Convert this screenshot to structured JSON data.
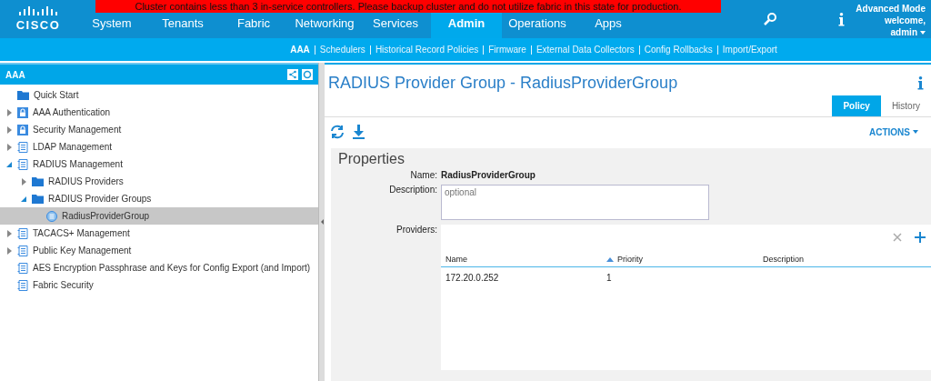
{
  "banner": {
    "text": "Cluster contains less than 3 in-service controllers. Please backup cluster and do not utilize fabric in this state for production."
  },
  "brand": {
    "logo_text": "CISCO"
  },
  "nav": [
    {
      "label": "System",
      "selected": false
    },
    {
      "label": "Tenants",
      "selected": false
    },
    {
      "label": "Fabric",
      "selected": false
    },
    {
      "label": "Networking",
      "selected": false
    },
    {
      "label": "Services",
      "selected": false
    },
    {
      "label": "Admin",
      "selected": true
    },
    {
      "label": "Operations",
      "selected": false
    },
    {
      "label": "Apps",
      "selected": false
    }
  ],
  "user": {
    "mode": "Advanced Mode",
    "welcome": "welcome,",
    "name": "admin"
  },
  "subnav": [
    "AAA",
    "Schedulers",
    "Historical Record Policies",
    "Firmware",
    "External Data Collectors",
    "Config Rollbacks",
    "Import/Export"
  ],
  "sidebar": {
    "title": "AAA",
    "items": [
      {
        "label": "Quick Start",
        "kind": "folder",
        "selected": false
      },
      {
        "label": "AAA Authentication",
        "kind": "lock",
        "expanded": false,
        "selected": false
      },
      {
        "label": "Security Management",
        "kind": "lock",
        "expanded": false,
        "selected": false
      },
      {
        "label": "LDAP Management",
        "kind": "doc",
        "expanded": false,
        "selected": false
      },
      {
        "label": "RADIUS Management",
        "kind": "doc",
        "expanded": true,
        "selected": false,
        "children": [
          {
            "label": "RADIUS Providers",
            "kind": "folder",
            "expanded": false,
            "selected": false
          },
          {
            "label": "RADIUS Provider Groups",
            "kind": "folder",
            "expanded": true,
            "selected": false,
            "children": [
              {
                "label": "RadiusProviderGroup",
                "kind": "object",
                "selected": true
              }
            ]
          }
        ]
      },
      {
        "label": "TACACS+ Management",
        "kind": "doc",
        "expanded": false,
        "selected": false
      },
      {
        "label": "Public Key Management",
        "kind": "doc",
        "expanded": false,
        "selected": false
      },
      {
        "label": "AES Encryption Passphrase and Keys for Config Export (and Import)",
        "kind": "doc",
        "selected": false
      },
      {
        "label": "Fabric Security",
        "kind": "doc",
        "selected": false
      }
    ]
  },
  "page": {
    "title": "RADIUS Provider Group - RadiusProviderGroup",
    "tabs": [
      {
        "label": "Policy",
        "selected": true
      },
      {
        "label": "History",
        "selected": false
      }
    ],
    "actions": "ACTIONS",
    "properties": {
      "title": "Properties",
      "name_label": "Name:",
      "name_value": "RadiusProviderGroup",
      "description_label": "Description:",
      "description_placeholder": "optional",
      "providers_label": "Providers:",
      "table": {
        "columns": [
          {
            "label": "Name",
            "sorted": false
          },
          {
            "label": "Priority",
            "sorted": true
          },
          {
            "label": "Description",
            "sorted": false
          }
        ],
        "rows": [
          [
            "172.20.0.252",
            "1",
            ""
          ]
        ]
      }
    }
  }
}
